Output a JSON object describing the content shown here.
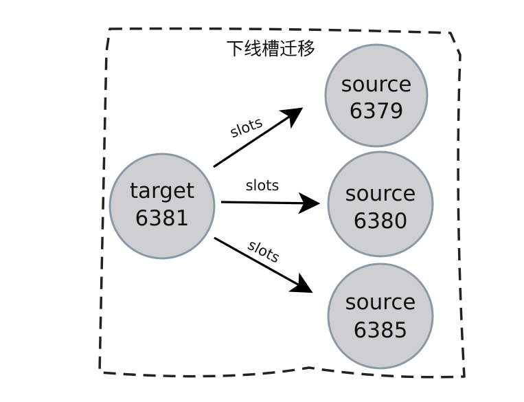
{
  "diagram": {
    "title": "下线槽迁移",
    "target": {
      "label": "target",
      "port": "6381"
    },
    "sources": [
      {
        "label": "source",
        "port": "6379"
      },
      {
        "label": "source",
        "port": "6380"
      },
      {
        "label": "source",
        "port": "6385"
      }
    ],
    "edges": [
      {
        "label": "slots"
      },
      {
        "label": "slots"
      },
      {
        "label": "slots"
      }
    ]
  }
}
